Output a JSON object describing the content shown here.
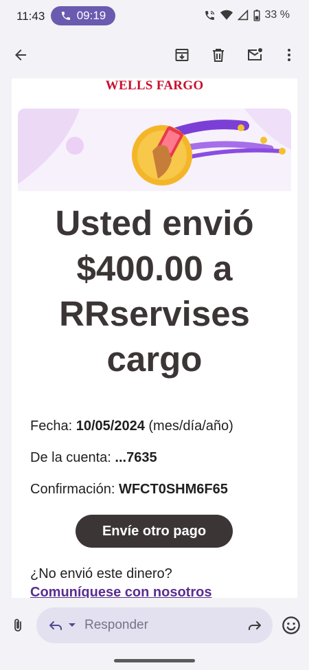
{
  "status_bar": {
    "time": "11:43",
    "call_timer": "09:19",
    "battery": "33 %"
  },
  "app_bar": {
    "actions": [
      "back-icon",
      "archive-icon",
      "delete-icon",
      "mark-unread-icon",
      "more-icon"
    ]
  },
  "email": {
    "brand": "WELLS FARGO",
    "brand_color": "#c8102e",
    "headline": [
      "Usted envió",
      "$400.00 a",
      "RRservises",
      "cargo"
    ],
    "details": [
      {
        "label": "Fecha:",
        "value": "10/05/2024",
        "suffix": "(mes/día/año)"
      },
      {
        "label": "De la cuenta:",
        "value": "...7635",
        "suffix": ""
      },
      {
        "label": "Confirmación:",
        "value": "WFCT0SHM6F65",
        "suffix": ""
      }
    ],
    "cta_label": "Envíe otro pago",
    "question": "¿No envió este dinero?",
    "contact_link": "Comuníquese con nosotros"
  },
  "reply_bar": {
    "placeholder": "Responder"
  },
  "colors": {
    "accent": "#6a5bb0",
    "button_bg": "#3b3536",
    "link": "#5a2d91"
  }
}
